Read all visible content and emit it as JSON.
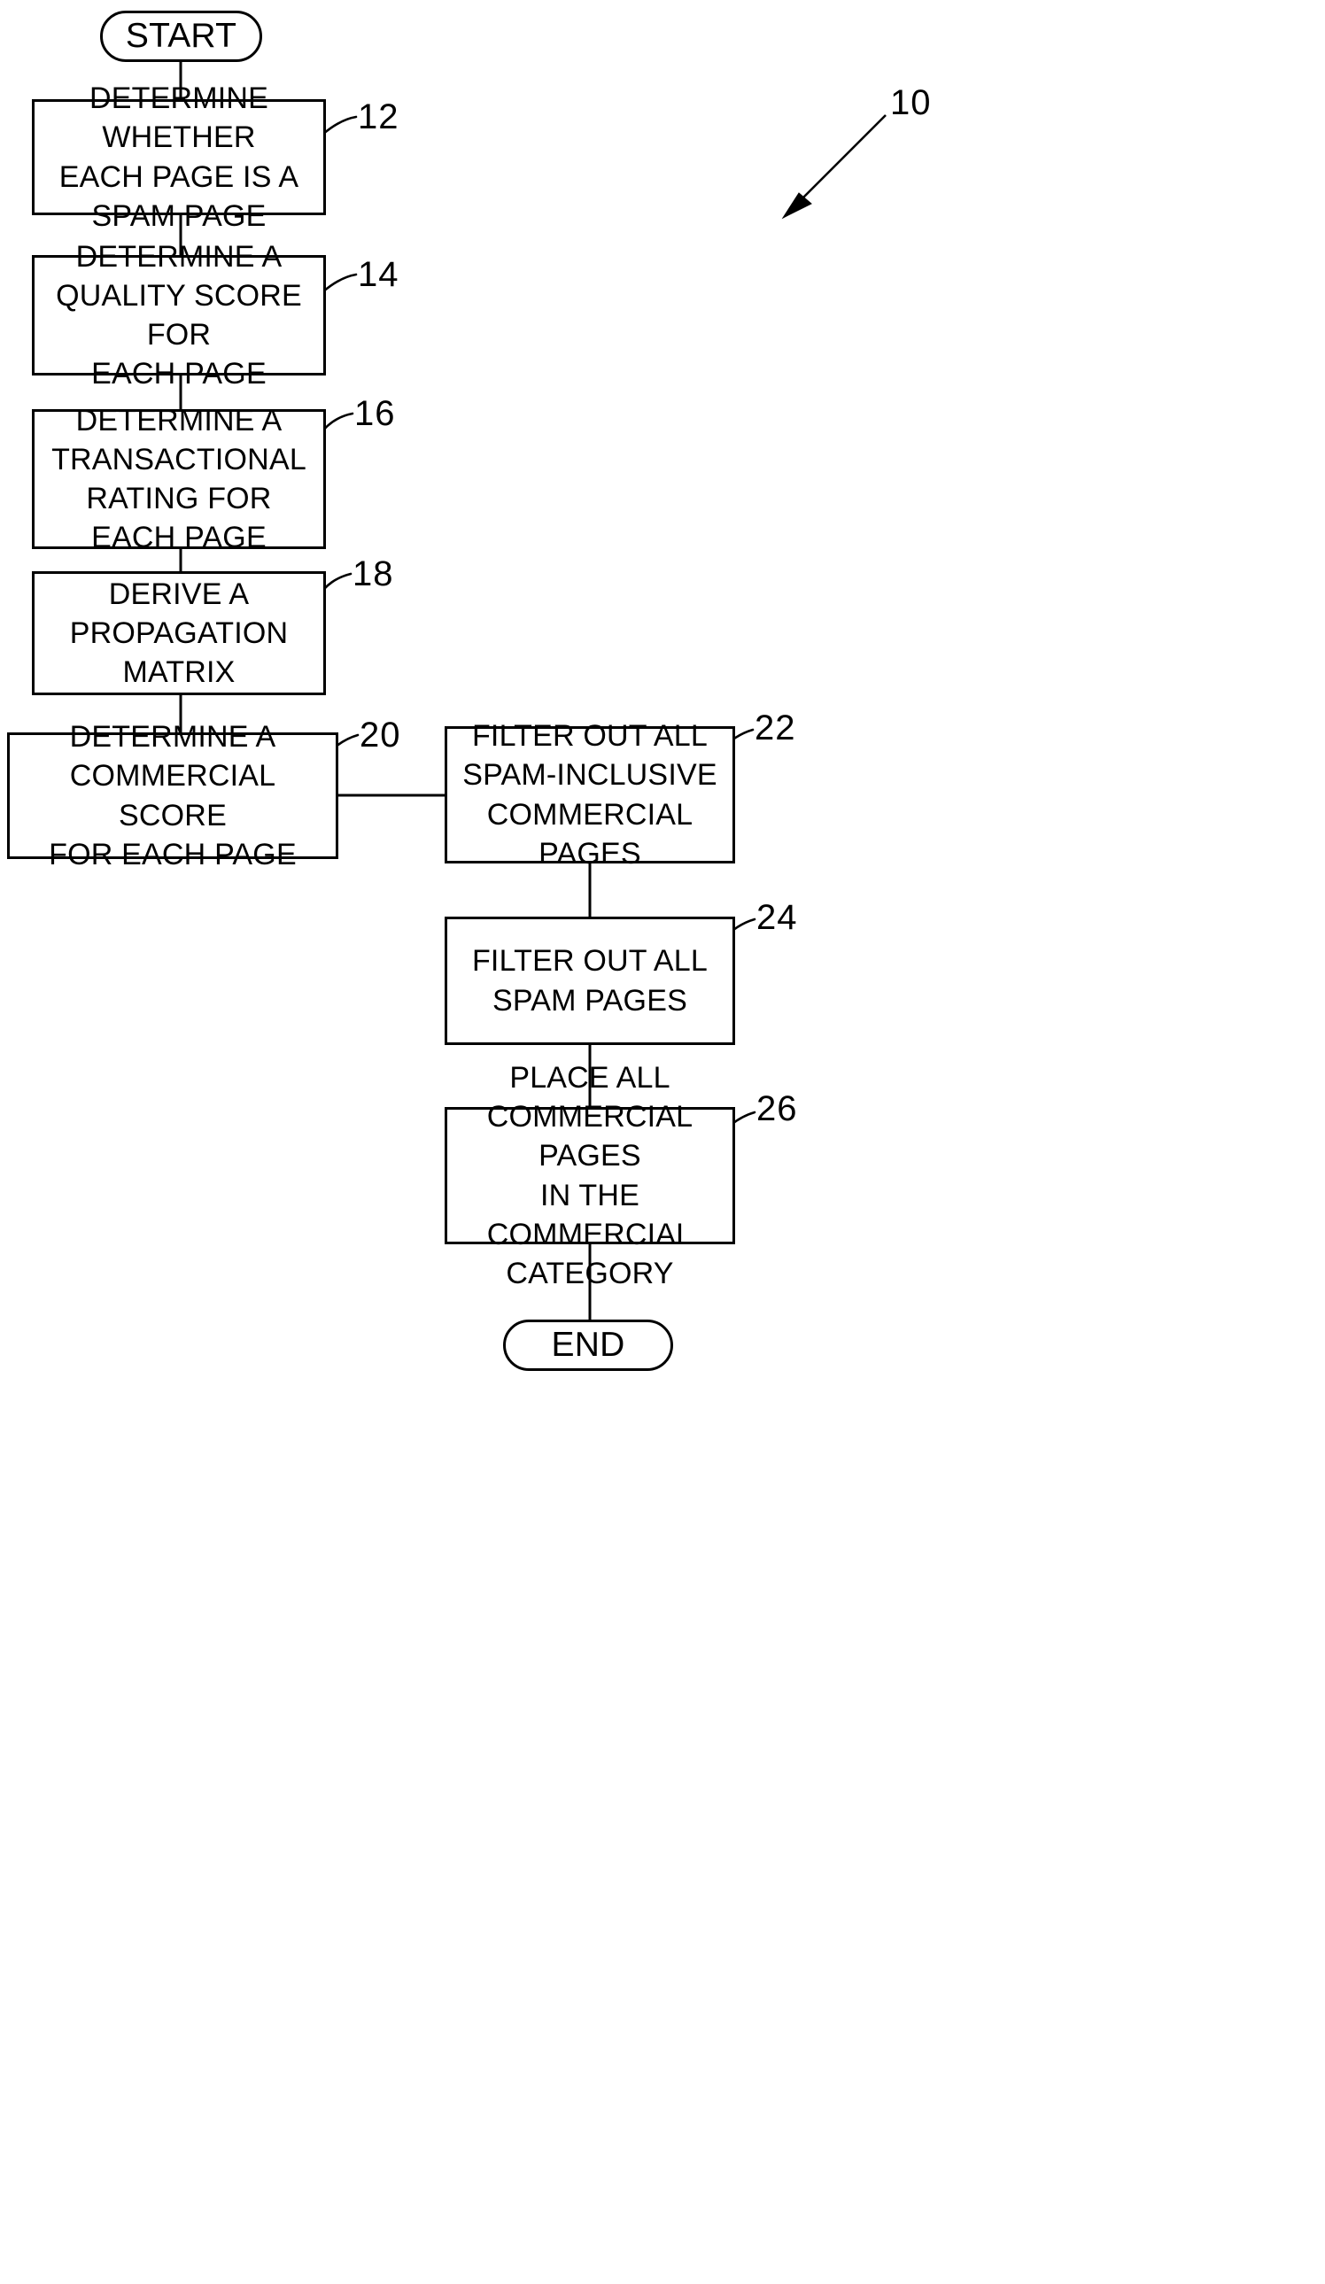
{
  "figure": {
    "reference_label": "10",
    "nodes": [
      {
        "id": "start",
        "kind": "terminator",
        "label": "START"
      },
      {
        "id": "n12",
        "kind": "process",
        "ref": "12",
        "label": "DETERMINE WHETHER\nEACH PAGE IS A\nSPAM PAGE"
      },
      {
        "id": "n14",
        "kind": "process",
        "ref": "14",
        "label": "DETERMINE A\nQUALITY SCORE FOR\nEACH PAGE"
      },
      {
        "id": "n16",
        "kind": "process",
        "ref": "16",
        "label": "DETERMINE A\nTRANSACTIONAL\nRATING FOR\nEACH  PAGE"
      },
      {
        "id": "n18",
        "kind": "process",
        "ref": "18",
        "label": "DERIVE A\nPROPAGATION MATRIX"
      },
      {
        "id": "n20",
        "kind": "process",
        "ref": "20",
        "label": "DETERMINE A\nCOMMERCIAL SCORE\nFOR EACH PAGE"
      },
      {
        "id": "n22",
        "kind": "process",
        "ref": "22",
        "label": "FILTER OUT ALL\nSPAM-INCLUSIVE\nCOMMERCIAL PAGES"
      },
      {
        "id": "n24",
        "kind": "process",
        "ref": "24",
        "label": "FILTER OUT ALL\nSPAM PAGES"
      },
      {
        "id": "n26",
        "kind": "process",
        "ref": "26",
        "label": "PLACE ALL\nCOMMERCIAL PAGES\nIN THE COMMERCIAL\nCATEGORY"
      },
      {
        "id": "end",
        "kind": "terminator",
        "label": "END"
      }
    ],
    "edges": [
      {
        "from": "start",
        "to": "n12"
      },
      {
        "from": "n12",
        "to": "n14"
      },
      {
        "from": "n14",
        "to": "n16"
      },
      {
        "from": "n16",
        "to": "n18"
      },
      {
        "from": "n18",
        "to": "n20"
      },
      {
        "from": "n20",
        "to": "n22"
      },
      {
        "from": "n22",
        "to": "n24"
      },
      {
        "from": "n24",
        "to": "n26"
      },
      {
        "from": "n26",
        "to": "end"
      }
    ],
    "colors": {
      "stroke": "#000000",
      "fill": "#ffffff",
      "text": "#000000"
    }
  }
}
